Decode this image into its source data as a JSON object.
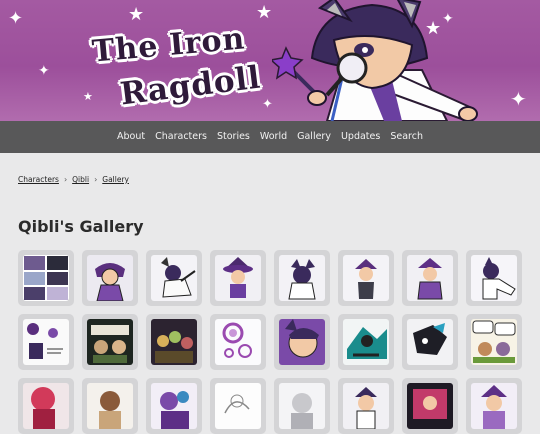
{
  "site": {
    "logo_line1": "The Iron",
    "logo_line2": "Ragdoll"
  },
  "nav": {
    "items": [
      "About",
      "Characters",
      "Stories",
      "World",
      "Gallery",
      "Updates",
      "Search"
    ]
  },
  "breadcrumb": {
    "items": [
      "Characters",
      "Qibli",
      "Gallery"
    ]
  },
  "page": {
    "title": "Qibli's Gallery"
  },
  "gallery": {
    "thumbnails": [
      {
        "subject": "comic-grid"
      },
      {
        "subject": "qibli-purple-hat"
      },
      {
        "subject": "qibli-dancing"
      },
      {
        "subject": "qibli-witch-hat"
      },
      {
        "subject": "qibli-back-view"
      },
      {
        "subject": "qibli-standing"
      },
      {
        "subject": "qibli-purple-coat"
      },
      {
        "subject": "qibli-pointing"
      },
      {
        "subject": "sketch-sheet"
      },
      {
        "subject": "group-green"
      },
      {
        "subject": "group-dark"
      },
      {
        "subject": "bubbles"
      },
      {
        "subject": "qibli-closeup"
      },
      {
        "subject": "teal-action"
      },
      {
        "subject": "dark-action"
      },
      {
        "subject": "comic-speech"
      },
      {
        "subject": "red-character"
      },
      {
        "subject": "brown-character"
      },
      {
        "subject": "purple-character"
      },
      {
        "subject": "line-sketch"
      },
      {
        "subject": "gray-sketch"
      },
      {
        "subject": "qibli-small"
      },
      {
        "subject": "pink-panel"
      },
      {
        "subject": "purple-panel"
      }
    ]
  },
  "colors": {
    "banner": "#a45aa2",
    "nav_bar": "#585859",
    "page_bg": "#e9e9ea",
    "tile_bg": "#d4d4d6"
  }
}
